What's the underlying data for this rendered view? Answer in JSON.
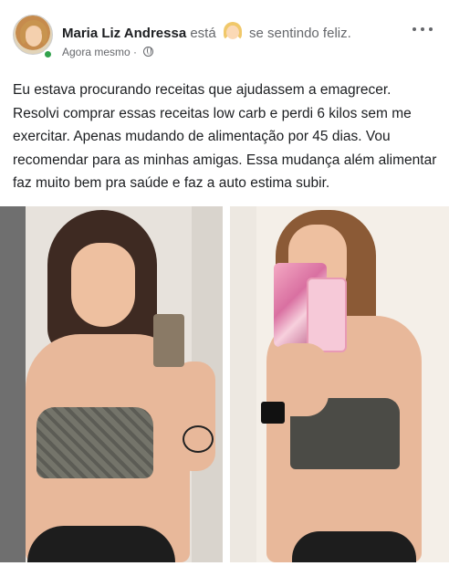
{
  "post": {
    "author_name": "Maria Liz Andressa",
    "feeling_prefix": "está",
    "feeling_text": "se sentindo feliz.",
    "timestamp": "Agora mesmo",
    "separator": "·",
    "body": "Eu estava procurando receitas que ajudassem a emagrecer. Resolvi comprar essas receitas low carb e perdi 6 kilos sem me exercitar. Apenas mudando de alimentação por 45 dias. Vou recomendar para as minhas amigas. Essa mudança além alimentar faz muito bem pra saúde e faz a auto estima subir.",
    "photos": [
      "before-photo",
      "after-photo"
    ]
  },
  "icons": {
    "more": "more-options-icon",
    "globe": "globe-icon",
    "emoji": "feeling-emoji-icon"
  },
  "colors": {
    "online": "#31a24c",
    "secondary_text": "#65676b",
    "primary_text": "#1c1e21"
  }
}
